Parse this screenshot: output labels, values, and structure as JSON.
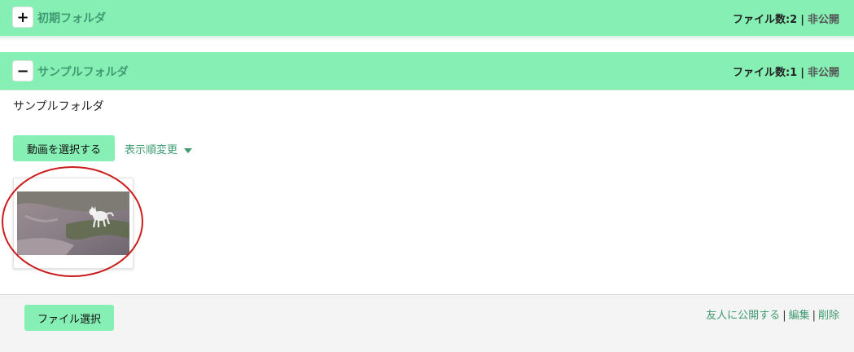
{
  "folders": [
    {
      "toggle": "+",
      "name": "初期フォルダ",
      "file_count": "ファイル数:2",
      "separator": "|",
      "visibility": "非公開"
    },
    {
      "toggle": "−",
      "name": "サンプルフォルダ",
      "file_count": "ファイル数:1",
      "separator": "|",
      "visibility": "非公開"
    }
  ],
  "content": {
    "description": "サンプルフォルダ",
    "select_video_label": "動画を選択する",
    "sort_label": "表示順変更"
  },
  "footer": {
    "file_select_label": "ファイル選択",
    "share_label": "友人に公開する",
    "edit_label": "編集",
    "delete_label": "削除",
    "separator": "|"
  },
  "colors": {
    "accent": "#86efb4",
    "link": "#3f9a72",
    "annotation": "#cc1b1b"
  }
}
